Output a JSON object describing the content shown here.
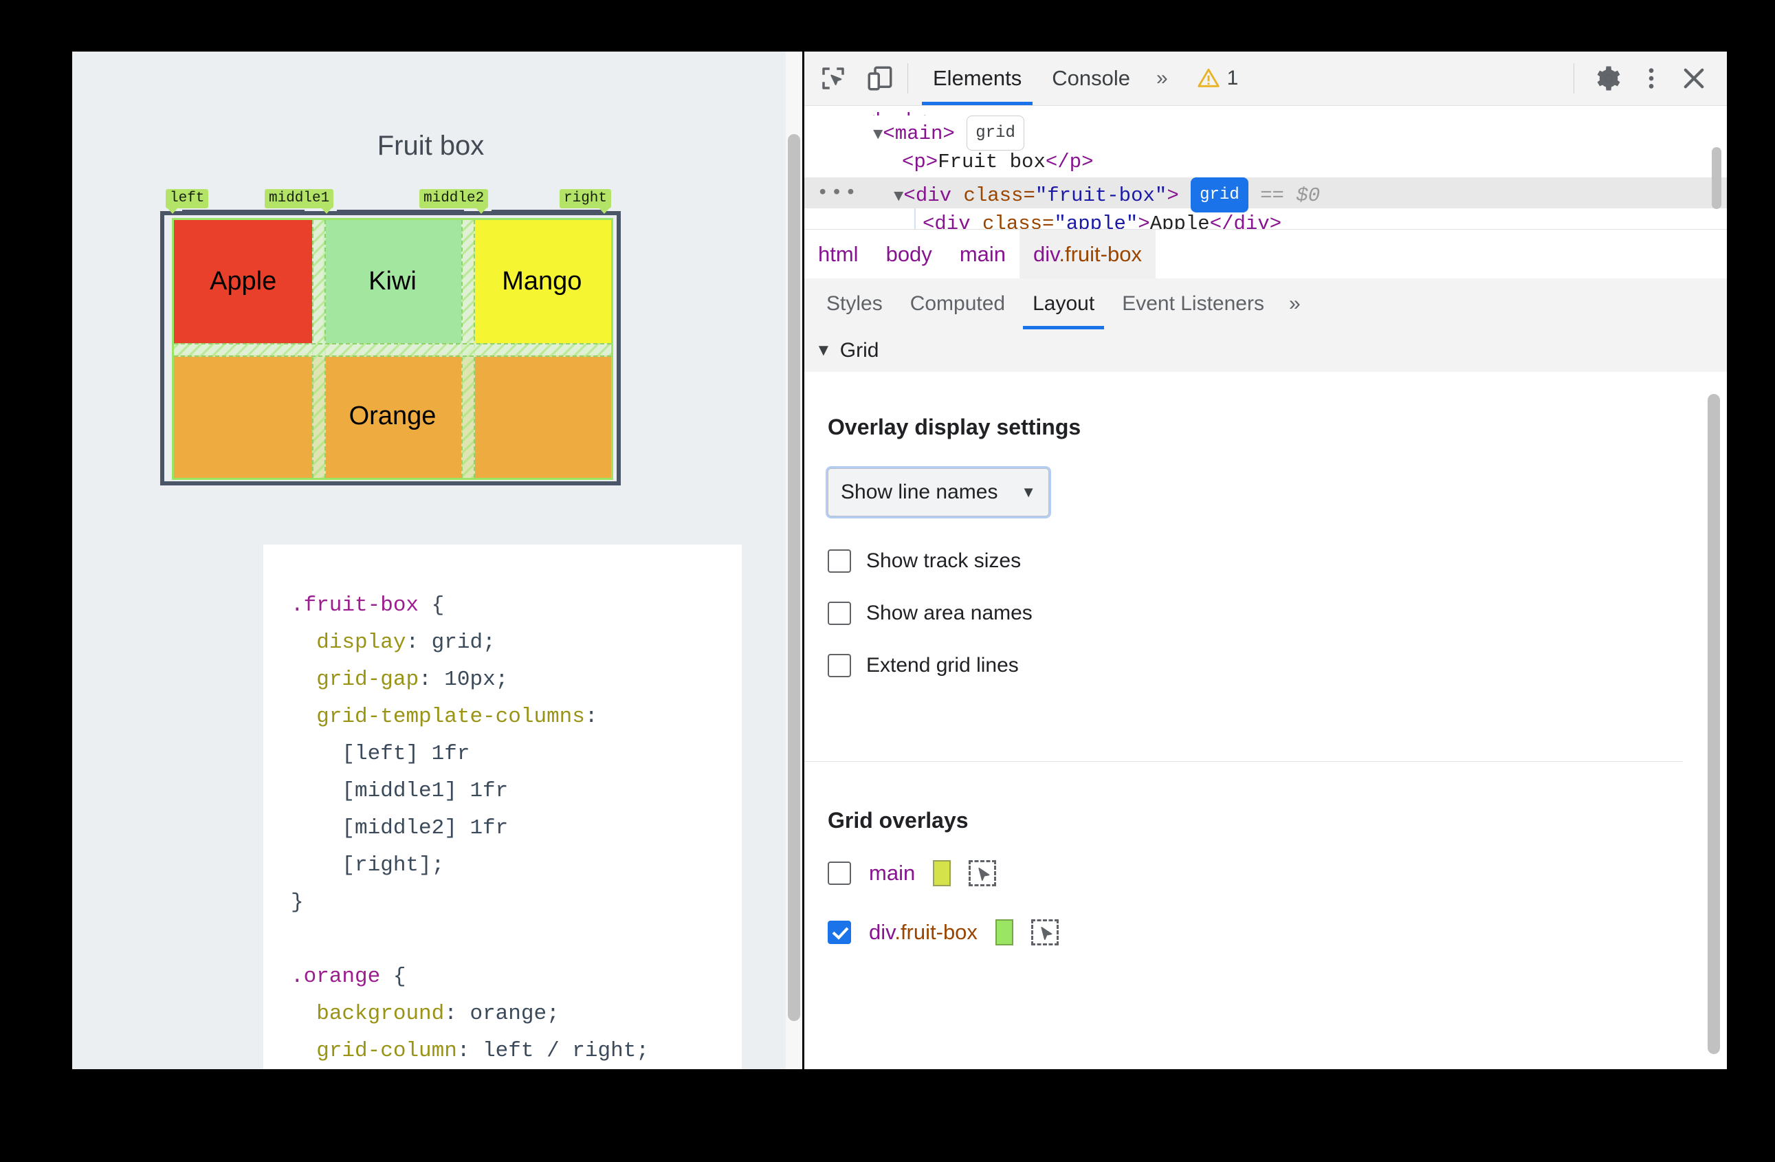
{
  "page": {
    "title": "Fruit box",
    "grid_labels": [
      "left",
      "middle1",
      "middle2",
      "right"
    ],
    "cells": [
      {
        "name": "Apple",
        "color": "#e8402a"
      },
      {
        "name": "Kiwi",
        "color": "#a3e6a0"
      },
      {
        "name": "Mango",
        "color": "#f5f531"
      },
      {
        "name": "Orange",
        "color": "#eeab40"
      }
    ],
    "code": {
      "rule1": {
        "selector": ".fruit-box",
        "open": " {",
        "lines": [
          {
            "prop": "display",
            "val": "grid;"
          },
          {
            "prop": "grid-gap",
            "val": "10px;"
          },
          {
            "prop": "grid-template-columns",
            "val": ""
          }
        ],
        "cols": [
          "[left] 1fr",
          "[middle1] 1fr",
          "[middle2] 1fr",
          "[right];"
        ],
        "close": "}"
      },
      "rule2": {
        "selector": ".orange",
        "open": " {",
        "lines": [
          {
            "prop": "background",
            "val": "orange;"
          },
          {
            "prop": "grid-column",
            "val": "left / right;"
          }
        ],
        "close": "}"
      }
    }
  },
  "devtools": {
    "toolbar": {
      "inspect_icon": "inspect-element-icon",
      "device_icon": "device-toolbar-icon",
      "tabs": [
        "Elements",
        "Console"
      ],
      "active_tab": "Elements",
      "more_tabs": "»",
      "warning_count": "1",
      "settings_icon": "gear-icon",
      "kebab_icon": "more-options-icon",
      "close_icon": "close-icon"
    },
    "dom_tree": {
      "rows": [
        {
          "type": "clipped"
        },
        {
          "type": "element",
          "indent": 1,
          "triangle": "▼",
          "tag_open": "<main>",
          "badge": "grid",
          "badge_on": false
        },
        {
          "type": "text_node",
          "indent": 2,
          "open": "<p>",
          "text": "Fruit box",
          "close": "</p>"
        },
        {
          "type": "element_sel",
          "indent": 2,
          "triangle": "▼",
          "tag": "div",
          "attr": "class",
          "value": "fruit-box",
          "badge": "grid",
          "badge_on": true,
          "suffix": "== $0",
          "dots": "•••"
        },
        {
          "type": "text_node2",
          "indent": 3,
          "tag": "div",
          "attr": "class",
          "value": "apple",
          "text": "Apple",
          "close": "</div>"
        }
      ]
    },
    "breadcrumbs": [
      {
        "label": "html",
        "active": false
      },
      {
        "label": "body",
        "active": false
      },
      {
        "label": "main",
        "active": false
      },
      {
        "label": "div",
        "cls": ".fruit-box",
        "active": true
      }
    ],
    "panel_tabs": {
      "items": [
        "Styles",
        "Computed",
        "Layout",
        "Event Listeners"
      ],
      "active": "Layout",
      "more": "»"
    },
    "layout": {
      "section_header": "Grid",
      "section_triangle": "▼",
      "overlay_settings_title": "Overlay display settings",
      "line_names_select": {
        "value": "Show line names",
        "caret": "▼"
      },
      "checkboxes": [
        {
          "label": "Show track sizes",
          "checked": false
        },
        {
          "label": "Show area names",
          "checked": false
        },
        {
          "label": "Extend grid lines",
          "checked": false
        }
      ],
      "overlays_title": "Grid overlays",
      "overlays": [
        {
          "name": "main",
          "cls": "",
          "checked": false,
          "color": "#d5e24a",
          "picker_icon": "element-picker-icon"
        },
        {
          "name": "div",
          "cls": ".fruit-box",
          "checked": true,
          "color": "#9be564",
          "picker_icon": "element-picker-icon"
        }
      ]
    }
  }
}
